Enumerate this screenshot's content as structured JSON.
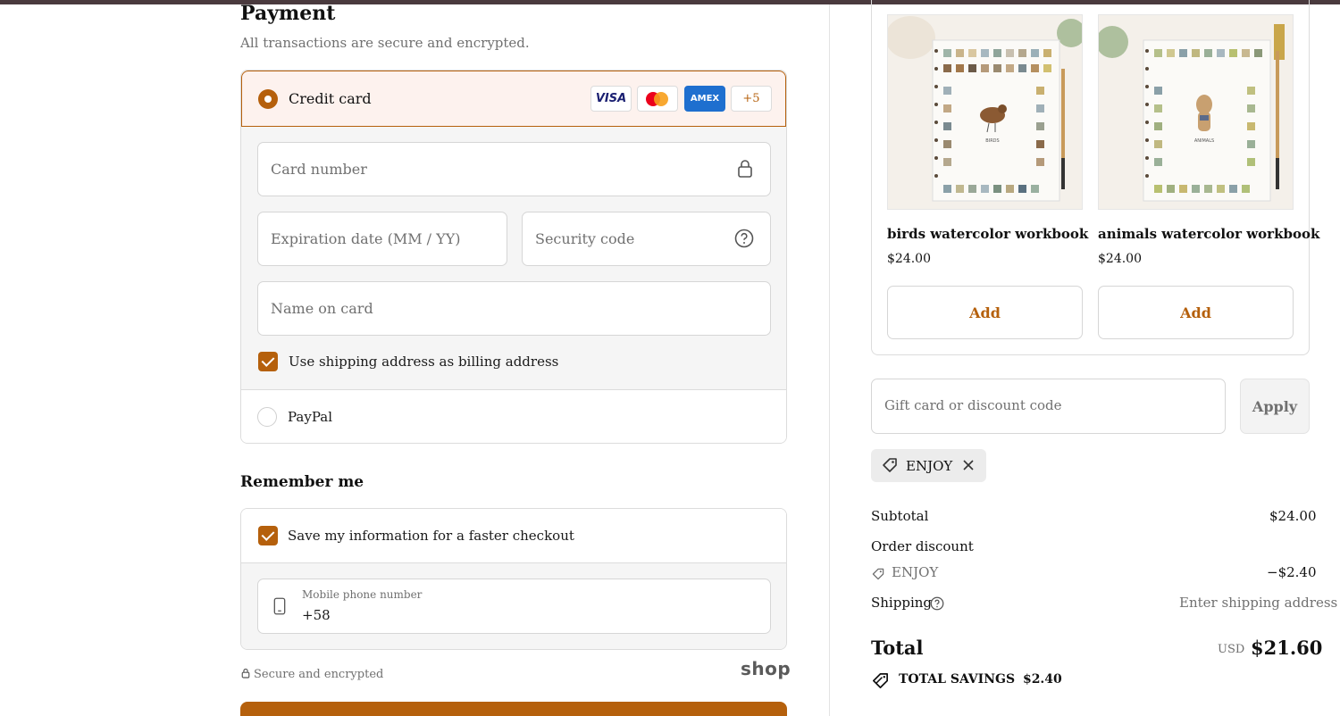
{
  "payment": {
    "title": "Payment",
    "subtitle": "All transactions are secure and encrypted.",
    "credit_card_label": "Credit card",
    "card_brands": [
      "VISA",
      "AMEX",
      "+5"
    ],
    "card_number_placeholder": "Card number",
    "expiration_placeholder": "Expiration date (MM / YY)",
    "security_code_placeholder": "Security code",
    "name_on_card_placeholder": "Name on card",
    "billing_same_label": "Use shipping address as billing address",
    "billing_same_checked": true,
    "paypal_label": "PayPal"
  },
  "remember": {
    "title": "Remember me",
    "save_info_label": "Save my information for a faster checkout",
    "save_info_checked": true,
    "phone_label": "Mobile phone number",
    "phone_value": "+58"
  },
  "footer": {
    "secure_text": "Secure and encrypted",
    "shop_logo": "shop"
  },
  "recommendations": [
    {
      "name": "birds watercolor workbook",
      "price": "$24.00",
      "add_label": "Add",
      "book_title": "BIRDS"
    },
    {
      "name": "animals watercolor workbook",
      "price": "$24.00",
      "add_label": "Add",
      "book_title": "ANIMALS"
    }
  ],
  "discount": {
    "placeholder": "Gift card or discount code",
    "apply_label": "Apply",
    "applied_code": "ENJOY"
  },
  "summary": {
    "subtotal_label": "Subtotal",
    "subtotal_value": "$24.00",
    "order_discount_label": "Order discount",
    "discount_code": "ENJOY",
    "discount_value": "−$2.40",
    "shipping_label": "Shipping",
    "shipping_value": "Enter shipping address",
    "total_label": "Total",
    "currency": "USD",
    "total_value": "$21.60",
    "savings_label": "TOTAL SAVINGS",
    "savings_value": "$2.40"
  },
  "colors": {
    "accent": "#b5600c",
    "topbar": "#4a3a3e",
    "muted_text": "#707070"
  }
}
